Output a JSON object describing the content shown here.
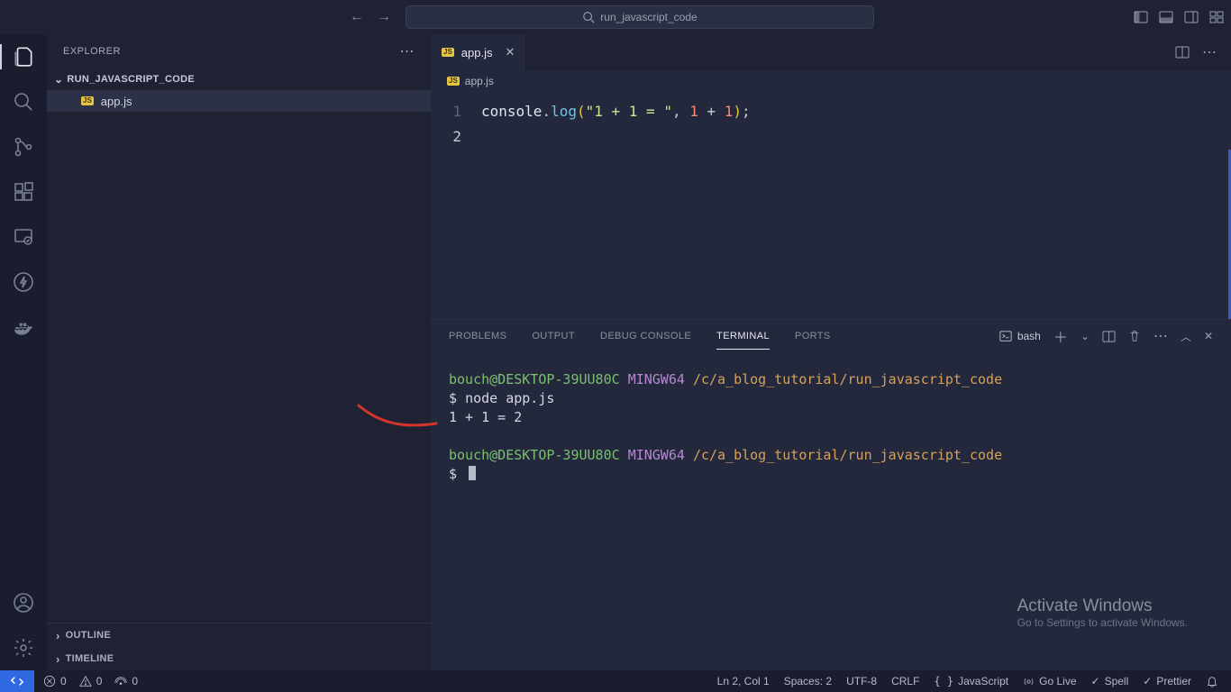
{
  "titlebar": {
    "search_text": "run_javascript_code"
  },
  "sidebar": {
    "title": "EXPLORER",
    "folder": "RUN_JAVASCRIPT_CODE",
    "file": "app.js",
    "outline": "OUTLINE",
    "timeline": "TIMELINE"
  },
  "editor": {
    "tab_file": "app.js",
    "breadcrumb_file": "app.js",
    "lines": {
      "l1": "1",
      "l2": "2"
    },
    "code": {
      "obj": "console",
      "fn": "log",
      "str": "\"1 + 1 = \"",
      "comma": ", ",
      "n1": "1",
      "plus": " + ",
      "n2": "1"
    }
  },
  "panel": {
    "tabs": {
      "problems": "PROBLEMS",
      "output": "OUTPUT",
      "debug": "DEBUG CONSOLE",
      "terminal": "TERMINAL",
      "ports": "PORTS"
    },
    "shell_kind": "bash",
    "term": {
      "userhost": "bouch@DESKTOP-39UU80C",
      "env": "MINGW64",
      "cwd": "/c/a_blog_tutorial/run_javascript_code",
      "prompt": "$",
      "cmd": "node app.js",
      "out": "1 + 1 =  2"
    }
  },
  "watermark": {
    "big": "Activate Windows",
    "small": "Go to Settings to activate Windows."
  },
  "status": {
    "errors": "0",
    "warnings": "0",
    "ports": "0",
    "lncol": "Ln 2, Col 1",
    "spaces": "Spaces: 2",
    "encoding": "UTF-8",
    "eol": "CRLF",
    "lang": "JavaScript",
    "golive": "Go Live",
    "spell": "Spell",
    "prettier": "Prettier"
  }
}
